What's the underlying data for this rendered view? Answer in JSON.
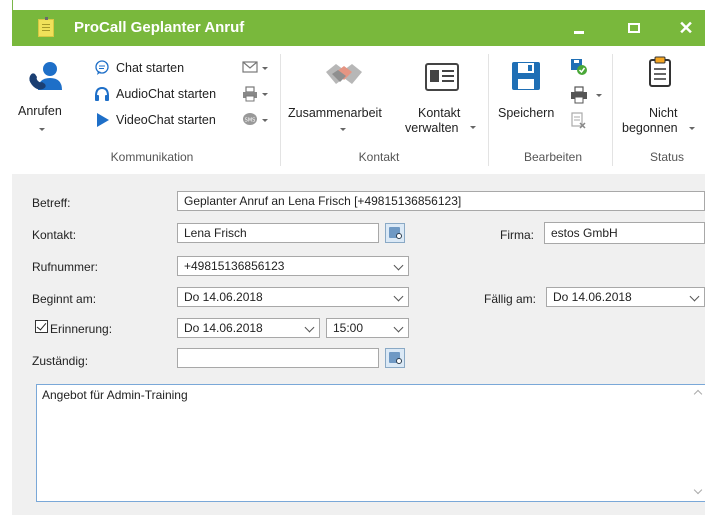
{
  "window": {
    "title": "ProCall Geplanter Anruf"
  },
  "ribbon": {
    "kommunikation": {
      "label": "Kommunikation",
      "call_label": "Anrufen",
      "chat": "Chat starten",
      "audio": "AudioChat starten",
      "video": "VideoChat starten"
    },
    "kontakt": {
      "label": "Kontakt",
      "collab": "Zusammenarbeit",
      "manage_line1": "Kontakt",
      "manage_line2": "verwalten"
    },
    "bearbeiten": {
      "label": "Bearbeiten",
      "save": "Speichern"
    },
    "status": {
      "label": "Status",
      "line1": "Nicht",
      "line2": "begonnen"
    }
  },
  "form": {
    "betreff_label": "Betreff:",
    "betreff_value": "Geplanter Anruf an Lena Frisch [+49815136856123]",
    "kontakt_label": "Kontakt:",
    "kontakt_value": "Lena Frisch",
    "firma_label": "Firma:",
    "firma_value": "estos GmbH",
    "rufnummer_label": "Rufnummer:",
    "rufnummer_value": "+49815136856123",
    "beginnt_label": "Beginnt am:",
    "beginnt_value": "Do 14.06.2018",
    "faellig_label": "Fällig am:",
    "faellig_value": "Do 14.06.2018",
    "erinnerung_label": "Erinnerung:",
    "erinnerung_date": "Do 14.06.2018",
    "erinnerung_time": "15:00",
    "zustaendig_label": "Zuständig:",
    "zustaendig_value": "",
    "notes": "Angebot für Admin-Training"
  },
  "colors": {
    "titlebar": "#79b83c",
    "accent_blue": "#1e6fc8",
    "save_blue": "#1f6fb5"
  }
}
